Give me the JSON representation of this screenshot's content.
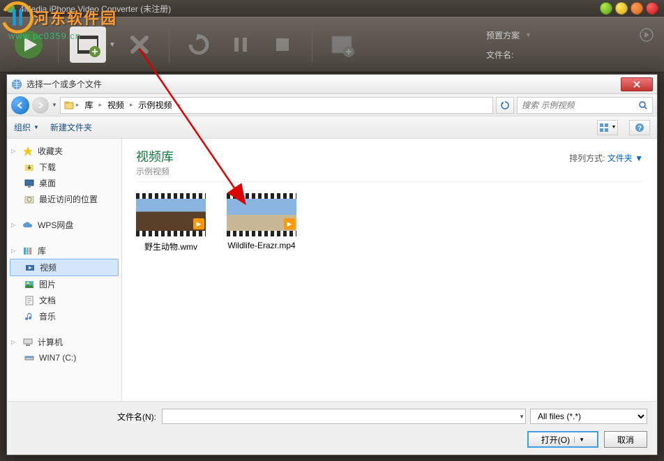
{
  "watermark": {
    "text": "河东软件园",
    "url": "www.pc0359.cn"
  },
  "app": {
    "title": "4Media iPhone Video Converter (未注册)",
    "preset_label": "预置方案",
    "filename_label": "文件名:"
  },
  "dialog": {
    "title": "选择一个或多个文件",
    "breadcrumb": [
      "库",
      "视频",
      "示例视频"
    ],
    "search_placeholder": "搜索 示例视频",
    "toolbar": {
      "organize": "组织",
      "new_folder": "新建文件夹"
    },
    "sidebar": {
      "favorites": {
        "label": "收藏夹",
        "items": [
          "下载",
          "桌面",
          "最近访问的位置"
        ]
      },
      "wps": {
        "label": "WPS网盘"
      },
      "libraries": {
        "label": "库",
        "items": [
          "视频",
          "图片",
          "文档",
          "音乐"
        ]
      },
      "computer": {
        "label": "计算机",
        "items": [
          "WIN7 (C:)"
        ]
      }
    },
    "content": {
      "lib_title": "视频库",
      "lib_sub": "示例视频",
      "sort_label": "排列方式:",
      "sort_value": "文件夹",
      "files": [
        {
          "name": "野生动物.wmv"
        },
        {
          "name": "Wildlife-Erazr.mp4"
        }
      ]
    },
    "footer": {
      "filename_label": "文件名(N):",
      "filetype": "All files (*.*)",
      "open": "打开(O)",
      "cancel": "取消"
    }
  }
}
